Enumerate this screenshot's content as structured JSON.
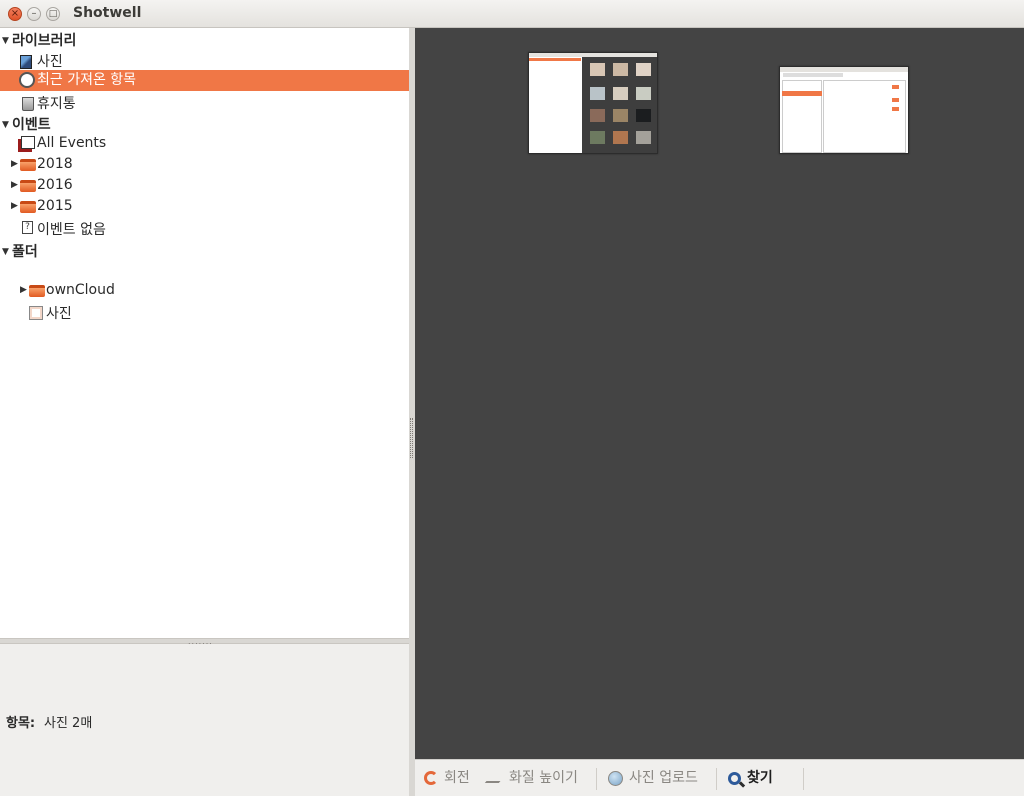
{
  "window": {
    "title": "Shotwell",
    "close_glyph": "×",
    "min_glyph": "–",
    "max_glyph": "□"
  },
  "sidebar": {
    "expander_open": "▼",
    "expander_closed": "▶",
    "library": {
      "label": "라이브러리",
      "items": [
        {
          "label": "사진",
          "icon": "photos-icon"
        },
        {
          "label": "최근 가져온 항목",
          "icon": "last-import-icon",
          "selected": true
        },
        {
          "label": "휴지통",
          "icon": "trash-icon"
        }
      ]
    },
    "events": {
      "label": "이벤트",
      "all_events": "All Events",
      "years": [
        "2018",
        "2016",
        "2015"
      ],
      "no_event": "이벤트 없음",
      "no_event_glyph": "?"
    },
    "folders": {
      "label": "폴더",
      "items": [
        "ownCloud",
        "사진"
      ]
    }
  },
  "info_panel": {
    "label": "항목:",
    "value": "사진 2매"
  },
  "toolbar": {
    "rotate": "회전",
    "enhance": "화질 높이기",
    "publish": "사진 업로드",
    "find": "찾기"
  },
  "colors": {
    "accent": "#f07746",
    "canvas": "#444444"
  }
}
